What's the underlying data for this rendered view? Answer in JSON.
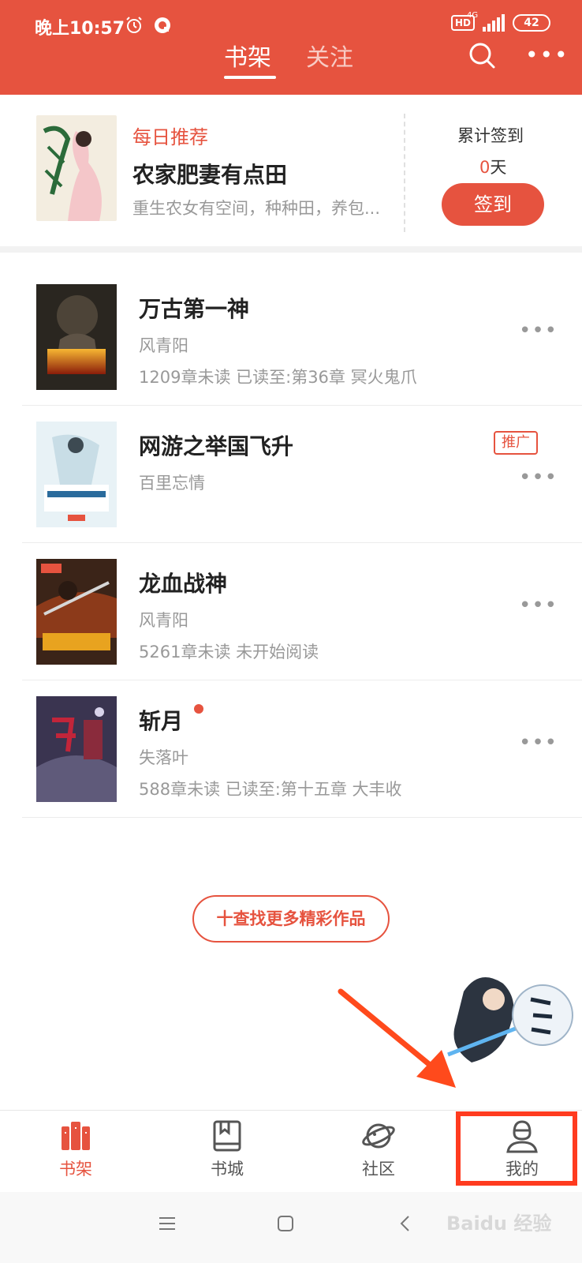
{
  "status_bar": {
    "time": "晚上10:57",
    "network": "4G",
    "hd_badge": "HD",
    "battery": "42"
  },
  "header": {
    "tabs": [
      {
        "label": "书架",
        "active": true
      },
      {
        "label": "关注",
        "active": false
      }
    ],
    "icons": [
      "search-icon",
      "more-icon"
    ]
  },
  "recommendation": {
    "label": "每日推荐",
    "title": "农家肥妻有点田",
    "description": "重生农女有空间，种种田，养包...",
    "checkin_label": "累计签到",
    "checkin_days": "0",
    "checkin_unit": "天",
    "checkin_button": "签到"
  },
  "books": [
    {
      "title": "万古第一神",
      "author": "风青阳",
      "progress": "1209章未读 已读至:第36章 冥火鬼爪",
      "badge": "",
      "new": false
    },
    {
      "title": "网游之举国飞升",
      "author": "百里忘情",
      "progress": "",
      "badge": "推广",
      "new": false
    },
    {
      "title": "龙血战神",
      "author": "风青阳",
      "progress": "5261章未读 未开始阅读",
      "badge": "",
      "new": false
    },
    {
      "title": "斩月",
      "author": "失落叶",
      "progress": "588章未读 已读至:第十五章 大丰收",
      "badge": "",
      "new": true
    }
  ],
  "more_button": "十查找更多精彩作品",
  "bottom_nav": [
    {
      "label": "书架",
      "icon": "bookshelf-icon",
      "active": true
    },
    {
      "label": "书城",
      "icon": "bookstore-icon",
      "active": false
    },
    {
      "label": "社区",
      "icon": "community-icon",
      "active": false
    },
    {
      "label": "我的",
      "icon": "profile-icon",
      "active": false
    }
  ],
  "watermark": "Baidu 经验",
  "colors": {
    "brand": "#e6533f",
    "annotation": "#ff3b1f"
  }
}
